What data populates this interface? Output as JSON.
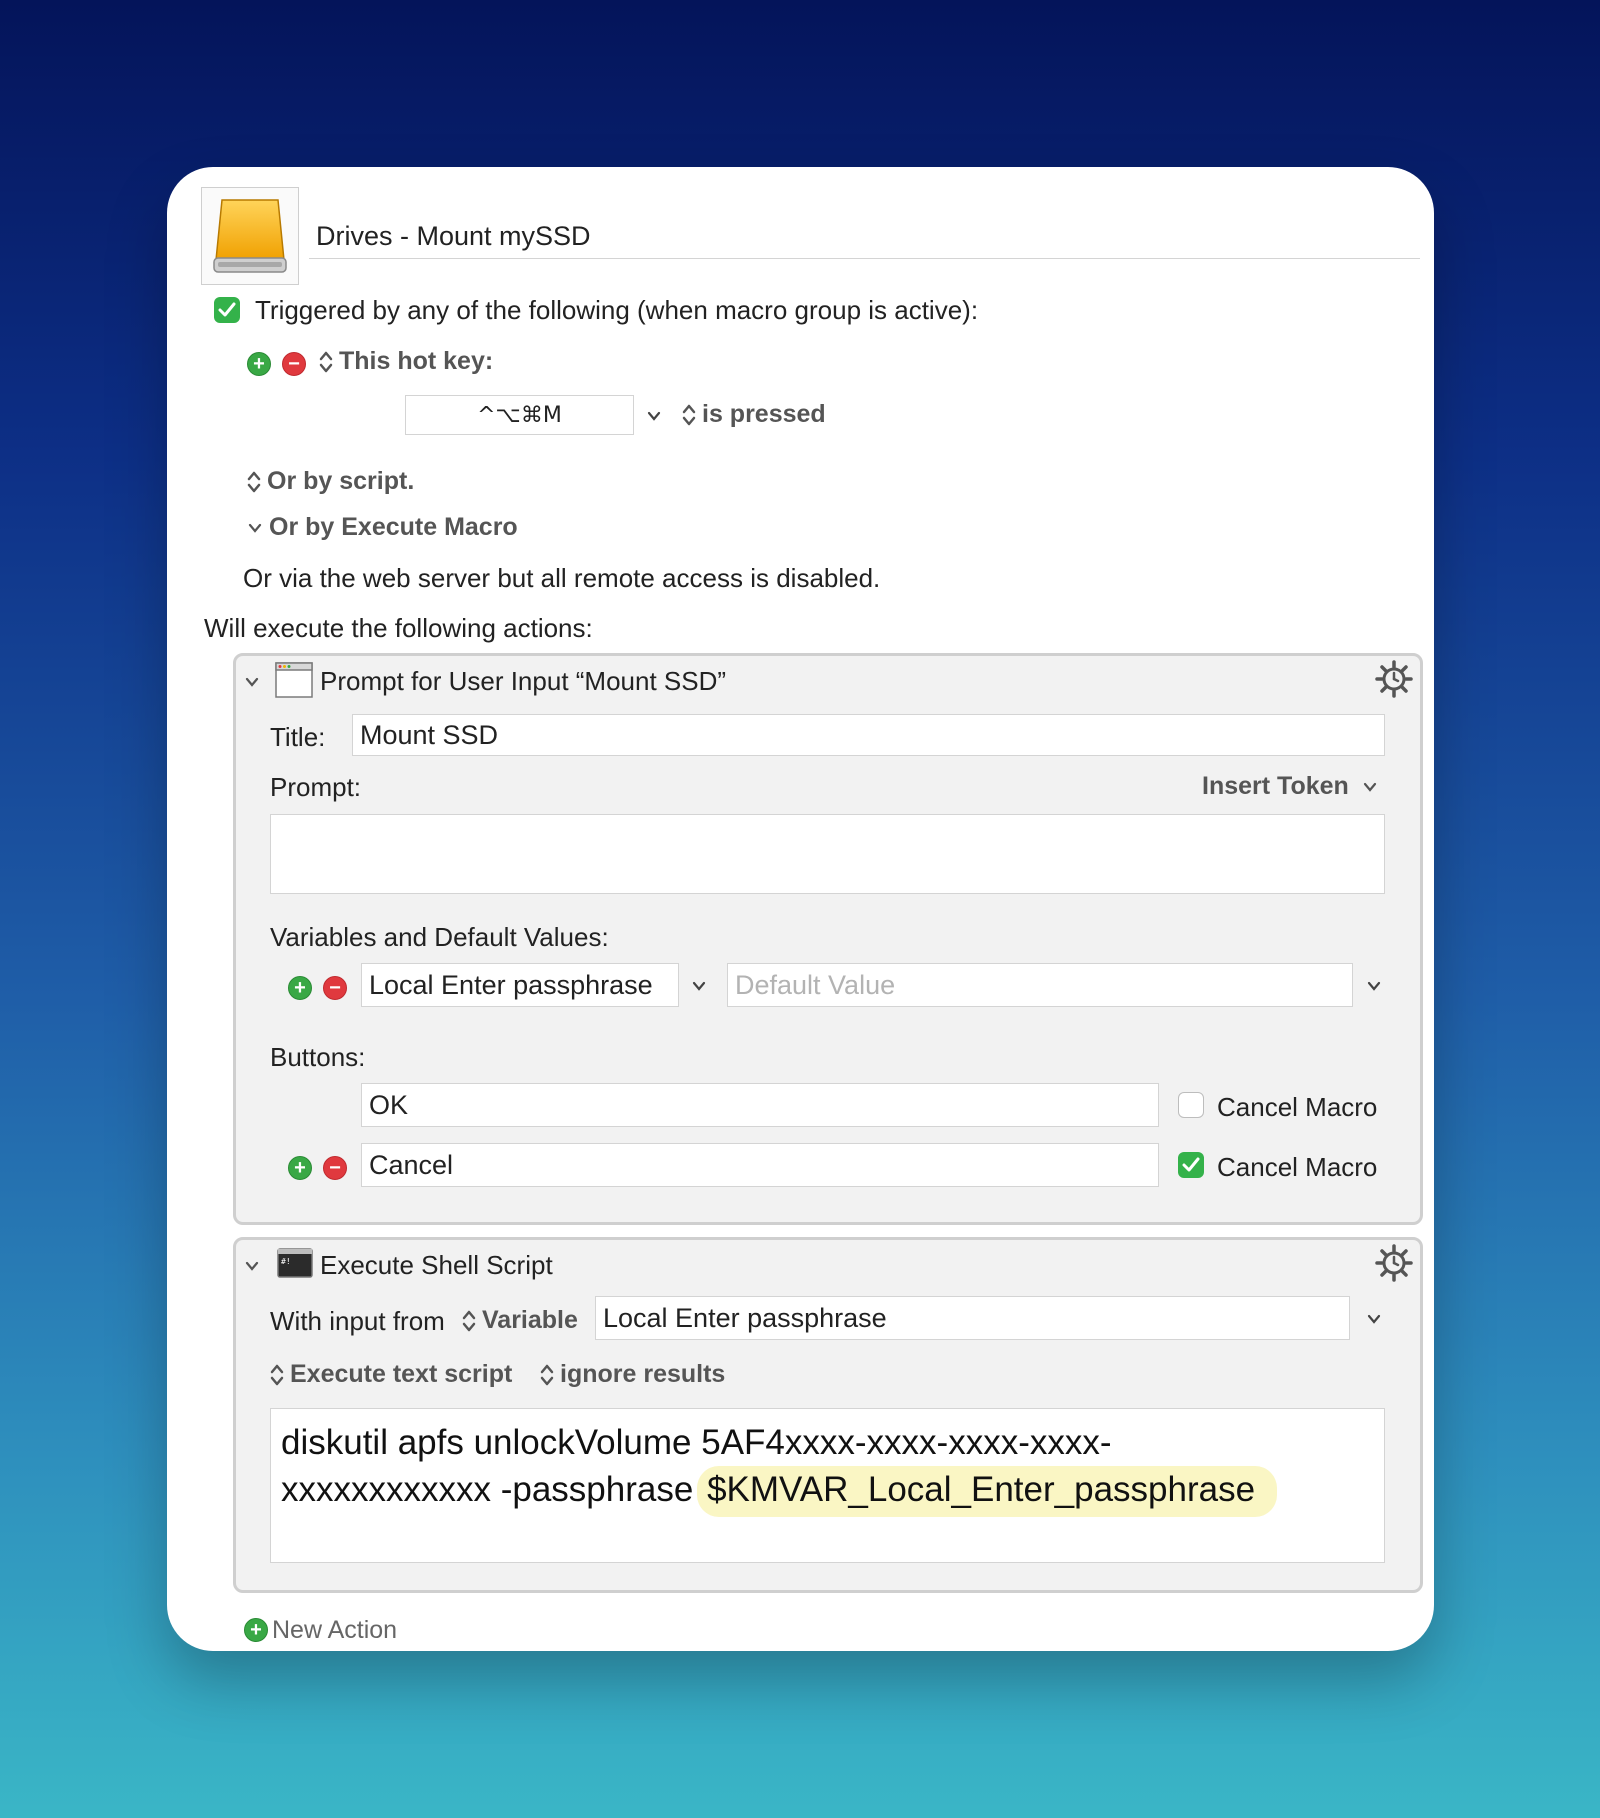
{
  "macro": {
    "name": "Drives - Mount mySSD",
    "icon": "external-drive-icon"
  },
  "triggers": {
    "enabled": true,
    "header": "Triggered by any of the following (when macro group is active):",
    "hotkey_type": "This hot key:",
    "hotkey_value": "^⌥⌘M",
    "hotkey_condition": "is pressed",
    "by_script": "Or by script.",
    "by_execute_macro": "Or by Execute Macro",
    "web_server": "Or via the web server but all remote access is disabled."
  },
  "actions_header": "Will execute the following actions:",
  "action1": {
    "title": "Prompt for User Input “Mount SSD”",
    "icon": "window-icon",
    "title_label": "Title:",
    "title_value": "Mount SSD",
    "prompt_label": "Prompt:",
    "insert_token": "Insert Token",
    "prompt_value": "",
    "variables_label": "Variables and Default Values:",
    "variable_name": "Local Enter passphrase",
    "default_placeholder": "Default Value",
    "buttons_label": "Buttons:",
    "buttons": [
      {
        "label": "OK",
        "cancel_checked": false,
        "cancel_label": "Cancel Macro"
      },
      {
        "label": "Cancel",
        "cancel_checked": true,
        "cancel_label": "Cancel Macro"
      }
    ]
  },
  "action2": {
    "title": "Execute Shell Script",
    "icon": "terminal-icon",
    "input_label": "With input from",
    "input_source": "Variable",
    "input_variable": "Local Enter passphrase",
    "execute_mode": "Execute text script",
    "results_mode": "ignore results",
    "script_line1": "diskutil apfs unlockVolume 5AF4xxxx-xxxx-xxxx-xxxx-",
    "script_line2_prefix": "xxxxxxxxxxxx -passphrase ",
    "script_highlight": "$KMVAR_Local_Enter_passphrase"
  },
  "new_action": "New Action",
  "colors": {
    "highlight": "#faf6c4",
    "check_green": "#34b24a",
    "plus_green": "#39a845",
    "minus_red": "#e0393e"
  }
}
